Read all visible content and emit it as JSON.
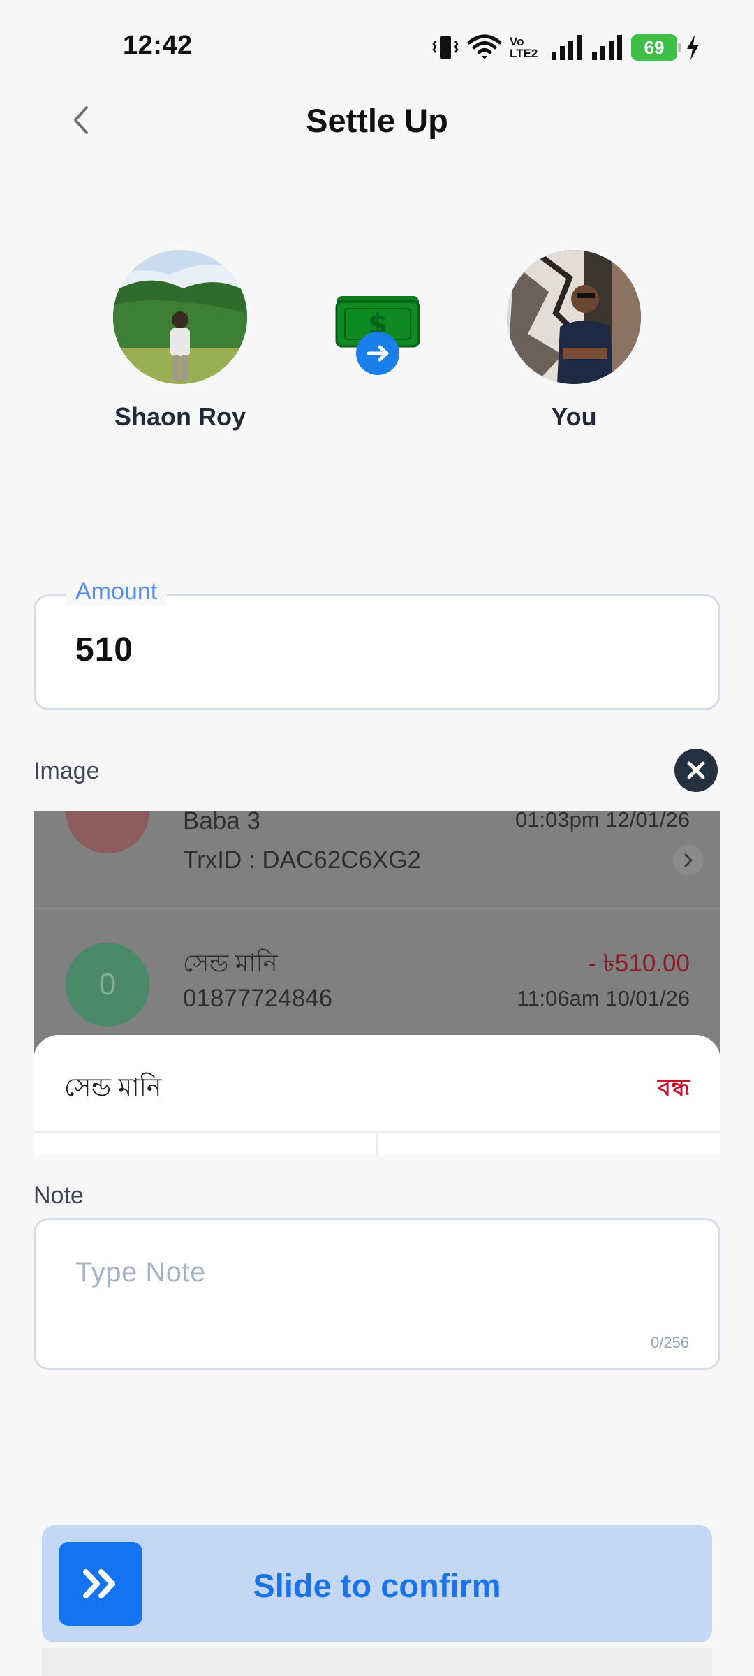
{
  "status_bar": {
    "time": "12:42",
    "network_badge": "Vo LTE2",
    "battery": "69",
    "icons": [
      "vibrate-icon",
      "wifi-icon",
      "signal-icon",
      "signal-icon",
      "battery-icon",
      "charging-icon"
    ]
  },
  "header": {
    "title": "Settle Up",
    "back_icon": "chevron-left-icon"
  },
  "parties": {
    "payer": {
      "name": "Shaon Roy"
    },
    "payee": {
      "name": "You"
    },
    "transfer_icon": "money-transfer-icon"
  },
  "amount": {
    "label": "Amount",
    "value": "510"
  },
  "image": {
    "label": "Image",
    "remove_icon": "close-icon",
    "attachment": {
      "row1": {
        "title": "Baba 3",
        "trx": "TrxID : DAC62C6XG2",
        "time": "01:03pm 12/01/26"
      },
      "row2": {
        "initial": "0",
        "title": "সেন্ড মানি",
        "number": "01877724846",
        "amount": "- ৳510.00",
        "time": "11:06am 10/01/26"
      },
      "sheet": {
        "title": "সেন্ড মানি",
        "close_label": "বন্ধ"
      }
    }
  },
  "note": {
    "label": "Note",
    "placeholder": "Type Note",
    "counter": "0/256"
  },
  "slider": {
    "label": "Slide to confirm",
    "icon": "double-chevron-right-icon"
  },
  "colors": {
    "accent": "#1473f0",
    "label_blue": "#4a8ff0",
    "slider_bg": "#c4d7f3",
    "negative": "#c8102e"
  }
}
